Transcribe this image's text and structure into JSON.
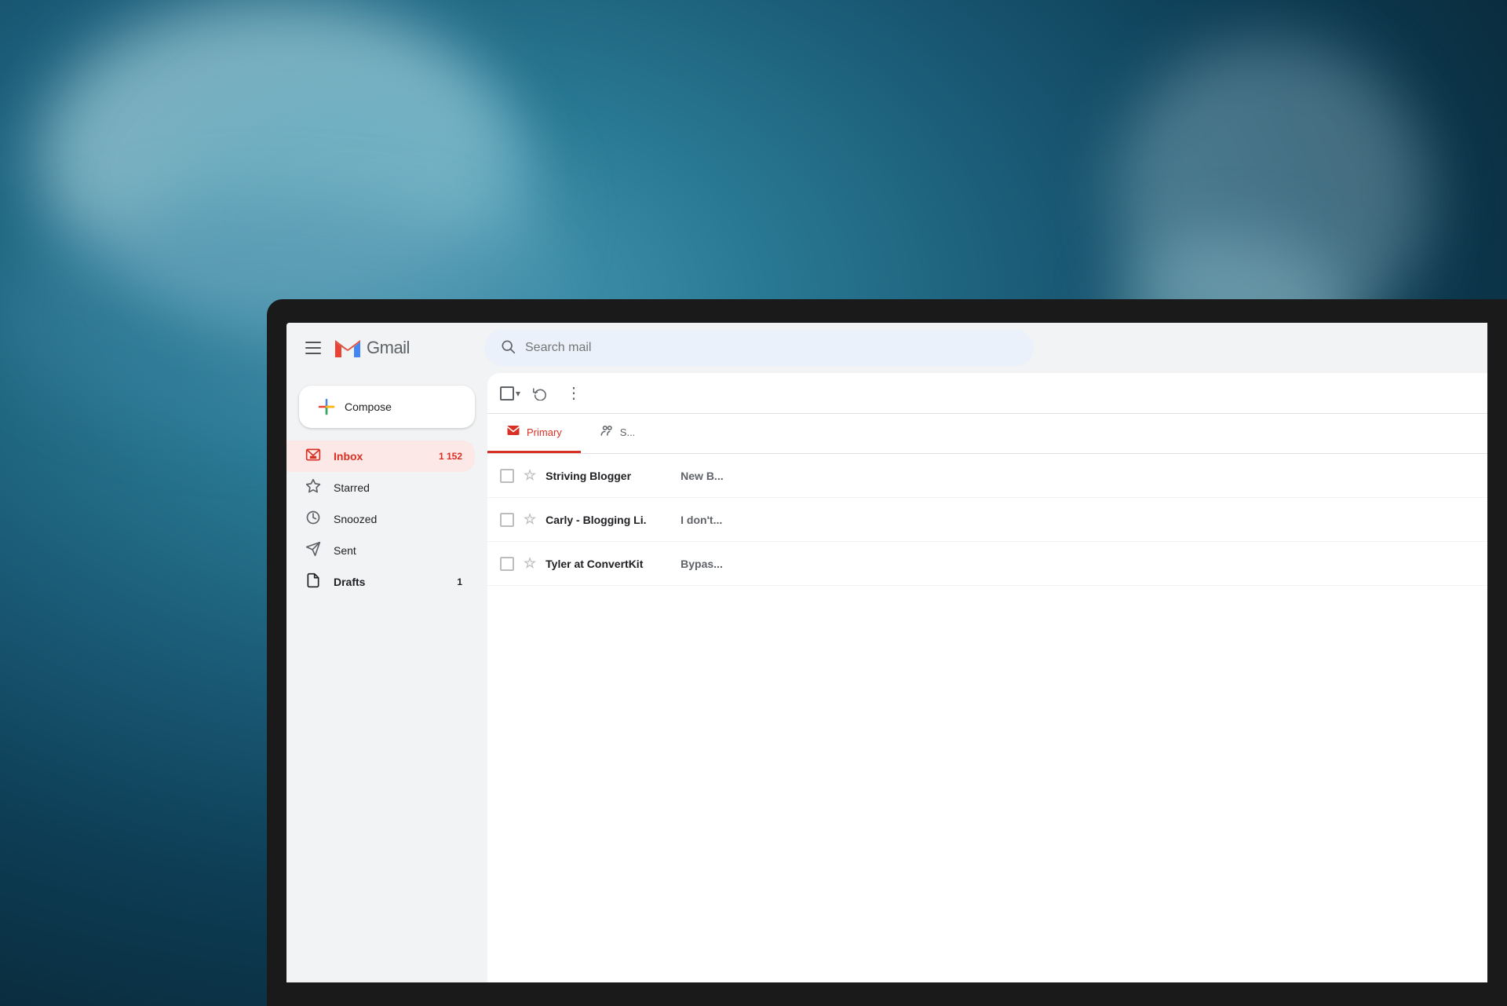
{
  "background": {
    "description": "blurred teal ocean/water background"
  },
  "gmail": {
    "header": {
      "menu_label": "Main menu",
      "logo_alt": "Gmail",
      "wordmark": "Gmail",
      "search_placeholder": "Search mail"
    },
    "sidebar": {
      "compose_label": "Compose",
      "nav_items": [
        {
          "id": "inbox",
          "label": "Inbox",
          "count": "1 152",
          "active": true,
          "icon": "inbox"
        },
        {
          "id": "starred",
          "label": "Starred",
          "count": "",
          "active": false,
          "icon": "star"
        },
        {
          "id": "snoozed",
          "label": "Snoozed",
          "count": "",
          "active": false,
          "icon": "clock"
        },
        {
          "id": "sent",
          "label": "Sent",
          "count": "",
          "active": false,
          "icon": "send"
        },
        {
          "id": "drafts",
          "label": "Drafts",
          "count": "1",
          "active": false,
          "icon": "draft"
        }
      ]
    },
    "toolbar": {
      "select_all_label": "Select all",
      "refresh_label": "Refresh",
      "more_label": "More"
    },
    "tabs": [
      {
        "id": "primary",
        "label": "Primary",
        "active": true,
        "icon": "chat"
      },
      {
        "id": "social",
        "label": "S...",
        "active": false,
        "icon": "people"
      }
    ],
    "emails": [
      {
        "id": 1,
        "sender": "Striving Blogger",
        "preview": "New B...",
        "unread": true,
        "starred": false
      },
      {
        "id": 2,
        "sender": "Carly - Blogging Li.",
        "preview": "I don't...",
        "unread": true,
        "starred": false
      },
      {
        "id": 3,
        "sender": "Tyler at ConvertKit",
        "preview": "Bypas...",
        "unread": true,
        "starred": false
      }
    ]
  }
}
